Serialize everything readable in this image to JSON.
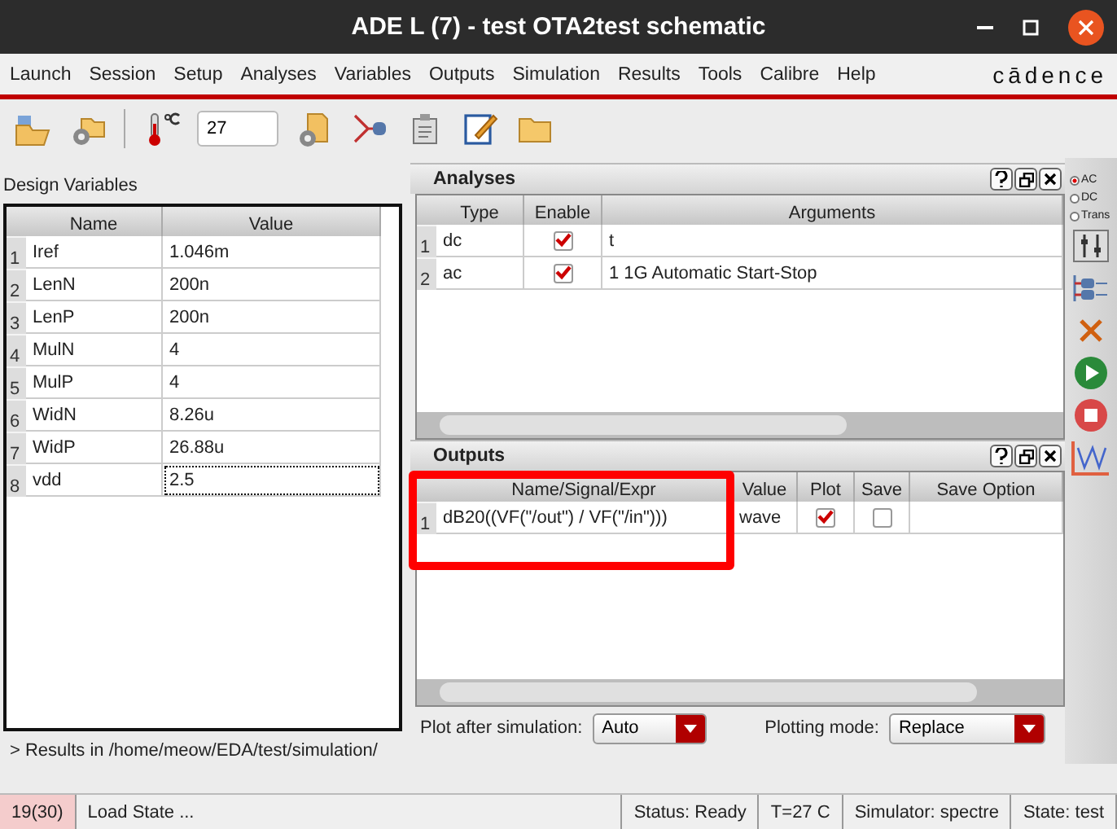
{
  "window": {
    "title": "ADE L (7) - test OTA2test schematic"
  },
  "menu": [
    "Launch",
    "Session",
    "Setup",
    "Analyses",
    "Variables",
    "Outputs",
    "Simulation",
    "Results",
    "Tools",
    "Calibre",
    "Help"
  ],
  "logo": "cādence",
  "toolbar": {
    "temperature": "27"
  },
  "design_variables": {
    "title": "Design Variables",
    "columns": [
      "Name",
      "Value"
    ],
    "rows": [
      {
        "index": "1",
        "name": "Iref",
        "value": "1.046m",
        "selected": false
      },
      {
        "index": "2",
        "name": "LenN",
        "value": "200n",
        "selected": false
      },
      {
        "index": "3",
        "name": "LenP",
        "value": "200n",
        "selected": false
      },
      {
        "index": "4",
        "name": "MulN",
        "value": "4",
        "selected": false
      },
      {
        "index": "5",
        "name": "MulP",
        "value": "4",
        "selected": false
      },
      {
        "index": "6",
        "name": "WidN",
        "value": "8.26u",
        "selected": false
      },
      {
        "index": "7",
        "name": "WidP",
        "value": "26.88u",
        "selected": false
      },
      {
        "index": "8",
        "name": "vdd",
        "value": "2.5",
        "selected": true
      }
    ]
  },
  "results_line": "> Results in /home/meow/EDA/test/simulation/",
  "analyses": {
    "title": "Analyses",
    "columns": [
      "Type",
      "Enable",
      "Arguments"
    ],
    "rows": [
      {
        "index": "1",
        "type": "dc",
        "enabled": true,
        "arguments": "t"
      },
      {
        "index": "2",
        "type": "ac",
        "enabled": true,
        "arguments": "1 1G Automatic Start-Stop"
      }
    ]
  },
  "outputs": {
    "title": "Outputs",
    "columns": [
      "Name/Signal/Expr",
      "Value",
      "Plot",
      "Save",
      "Save Option"
    ],
    "rows": [
      {
        "index": "1",
        "expr": "dB20((VF(\"/out\") / VF(\"/in\")))",
        "value": "wave",
        "plot": true,
        "save": false
      }
    ],
    "plot_after_label": "Plot after simulation:",
    "plot_after": "Auto",
    "plotting_mode_label": "Plotting mode:",
    "plotting_mode": "Replace"
  },
  "analysis_types": [
    {
      "label": "AC",
      "selected": true
    },
    {
      "label": "DC",
      "selected": false
    },
    {
      "label": "Trans",
      "selected": false
    }
  ],
  "status_bar": [
    "19(30)",
    "Load State ...",
    "Status: Ready",
    "T=27  C",
    "Simulator: spectre",
    "State: test"
  ]
}
